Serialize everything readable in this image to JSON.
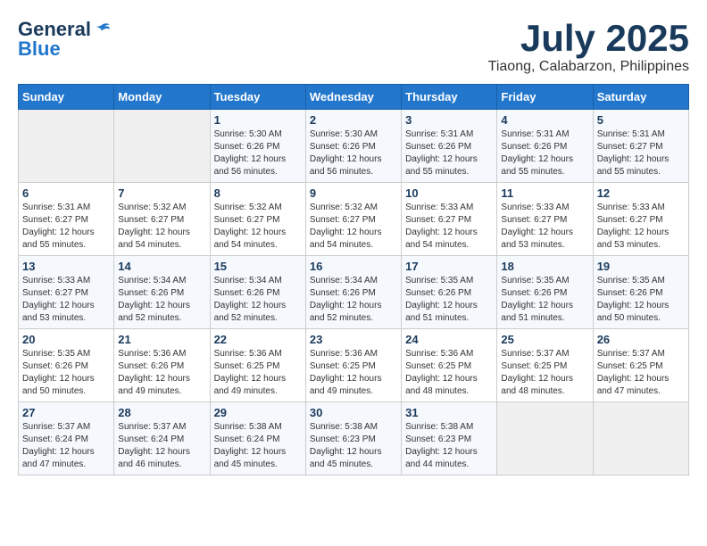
{
  "logo": {
    "general": "General",
    "blue": "Blue"
  },
  "title": {
    "month_year": "July 2025",
    "location": "Tiaong, Calabarzon, Philippines"
  },
  "weekdays": [
    "Sunday",
    "Monday",
    "Tuesday",
    "Wednesday",
    "Thursday",
    "Friday",
    "Saturday"
  ],
  "weeks": [
    [
      {
        "day": "",
        "sunrise": "",
        "sunset": "",
        "daylight": ""
      },
      {
        "day": "",
        "sunrise": "",
        "sunset": "",
        "daylight": ""
      },
      {
        "day": "1",
        "sunrise": "Sunrise: 5:30 AM",
        "sunset": "Sunset: 6:26 PM",
        "daylight": "Daylight: 12 hours and 56 minutes."
      },
      {
        "day": "2",
        "sunrise": "Sunrise: 5:30 AM",
        "sunset": "Sunset: 6:26 PM",
        "daylight": "Daylight: 12 hours and 56 minutes."
      },
      {
        "day": "3",
        "sunrise": "Sunrise: 5:31 AM",
        "sunset": "Sunset: 6:26 PM",
        "daylight": "Daylight: 12 hours and 55 minutes."
      },
      {
        "day": "4",
        "sunrise": "Sunrise: 5:31 AM",
        "sunset": "Sunset: 6:26 PM",
        "daylight": "Daylight: 12 hours and 55 minutes."
      },
      {
        "day": "5",
        "sunrise": "Sunrise: 5:31 AM",
        "sunset": "Sunset: 6:27 PM",
        "daylight": "Daylight: 12 hours and 55 minutes."
      }
    ],
    [
      {
        "day": "6",
        "sunrise": "Sunrise: 5:31 AM",
        "sunset": "Sunset: 6:27 PM",
        "daylight": "Daylight: 12 hours and 55 minutes."
      },
      {
        "day": "7",
        "sunrise": "Sunrise: 5:32 AM",
        "sunset": "Sunset: 6:27 PM",
        "daylight": "Daylight: 12 hours and 54 minutes."
      },
      {
        "day": "8",
        "sunrise": "Sunrise: 5:32 AM",
        "sunset": "Sunset: 6:27 PM",
        "daylight": "Daylight: 12 hours and 54 minutes."
      },
      {
        "day": "9",
        "sunrise": "Sunrise: 5:32 AM",
        "sunset": "Sunset: 6:27 PM",
        "daylight": "Daylight: 12 hours and 54 minutes."
      },
      {
        "day": "10",
        "sunrise": "Sunrise: 5:33 AM",
        "sunset": "Sunset: 6:27 PM",
        "daylight": "Daylight: 12 hours and 54 minutes."
      },
      {
        "day": "11",
        "sunrise": "Sunrise: 5:33 AM",
        "sunset": "Sunset: 6:27 PM",
        "daylight": "Daylight: 12 hours and 53 minutes."
      },
      {
        "day": "12",
        "sunrise": "Sunrise: 5:33 AM",
        "sunset": "Sunset: 6:27 PM",
        "daylight": "Daylight: 12 hours and 53 minutes."
      }
    ],
    [
      {
        "day": "13",
        "sunrise": "Sunrise: 5:33 AM",
        "sunset": "Sunset: 6:27 PM",
        "daylight": "Daylight: 12 hours and 53 minutes."
      },
      {
        "day": "14",
        "sunrise": "Sunrise: 5:34 AM",
        "sunset": "Sunset: 6:26 PM",
        "daylight": "Daylight: 12 hours and 52 minutes."
      },
      {
        "day": "15",
        "sunrise": "Sunrise: 5:34 AM",
        "sunset": "Sunset: 6:26 PM",
        "daylight": "Daylight: 12 hours and 52 minutes."
      },
      {
        "day": "16",
        "sunrise": "Sunrise: 5:34 AM",
        "sunset": "Sunset: 6:26 PM",
        "daylight": "Daylight: 12 hours and 52 minutes."
      },
      {
        "day": "17",
        "sunrise": "Sunrise: 5:35 AM",
        "sunset": "Sunset: 6:26 PM",
        "daylight": "Daylight: 12 hours and 51 minutes."
      },
      {
        "day": "18",
        "sunrise": "Sunrise: 5:35 AM",
        "sunset": "Sunset: 6:26 PM",
        "daylight": "Daylight: 12 hours and 51 minutes."
      },
      {
        "day": "19",
        "sunrise": "Sunrise: 5:35 AM",
        "sunset": "Sunset: 6:26 PM",
        "daylight": "Daylight: 12 hours and 50 minutes."
      }
    ],
    [
      {
        "day": "20",
        "sunrise": "Sunrise: 5:35 AM",
        "sunset": "Sunset: 6:26 PM",
        "daylight": "Daylight: 12 hours and 50 minutes."
      },
      {
        "day": "21",
        "sunrise": "Sunrise: 5:36 AM",
        "sunset": "Sunset: 6:26 PM",
        "daylight": "Daylight: 12 hours and 49 minutes."
      },
      {
        "day": "22",
        "sunrise": "Sunrise: 5:36 AM",
        "sunset": "Sunset: 6:25 PM",
        "daylight": "Daylight: 12 hours and 49 minutes."
      },
      {
        "day": "23",
        "sunrise": "Sunrise: 5:36 AM",
        "sunset": "Sunset: 6:25 PM",
        "daylight": "Daylight: 12 hours and 49 minutes."
      },
      {
        "day": "24",
        "sunrise": "Sunrise: 5:36 AM",
        "sunset": "Sunset: 6:25 PM",
        "daylight": "Daylight: 12 hours and 48 minutes."
      },
      {
        "day": "25",
        "sunrise": "Sunrise: 5:37 AM",
        "sunset": "Sunset: 6:25 PM",
        "daylight": "Daylight: 12 hours and 48 minutes."
      },
      {
        "day": "26",
        "sunrise": "Sunrise: 5:37 AM",
        "sunset": "Sunset: 6:25 PM",
        "daylight": "Daylight: 12 hours and 47 minutes."
      }
    ],
    [
      {
        "day": "27",
        "sunrise": "Sunrise: 5:37 AM",
        "sunset": "Sunset: 6:24 PM",
        "daylight": "Daylight: 12 hours and 47 minutes."
      },
      {
        "day": "28",
        "sunrise": "Sunrise: 5:37 AM",
        "sunset": "Sunset: 6:24 PM",
        "daylight": "Daylight: 12 hours and 46 minutes."
      },
      {
        "day": "29",
        "sunrise": "Sunrise: 5:38 AM",
        "sunset": "Sunset: 6:24 PM",
        "daylight": "Daylight: 12 hours and 45 minutes."
      },
      {
        "day": "30",
        "sunrise": "Sunrise: 5:38 AM",
        "sunset": "Sunset: 6:23 PM",
        "daylight": "Daylight: 12 hours and 45 minutes."
      },
      {
        "day": "31",
        "sunrise": "Sunrise: 5:38 AM",
        "sunset": "Sunset: 6:23 PM",
        "daylight": "Daylight: 12 hours and 44 minutes."
      },
      {
        "day": "",
        "sunrise": "",
        "sunset": "",
        "daylight": ""
      },
      {
        "day": "",
        "sunrise": "",
        "sunset": "",
        "daylight": ""
      }
    ]
  ]
}
